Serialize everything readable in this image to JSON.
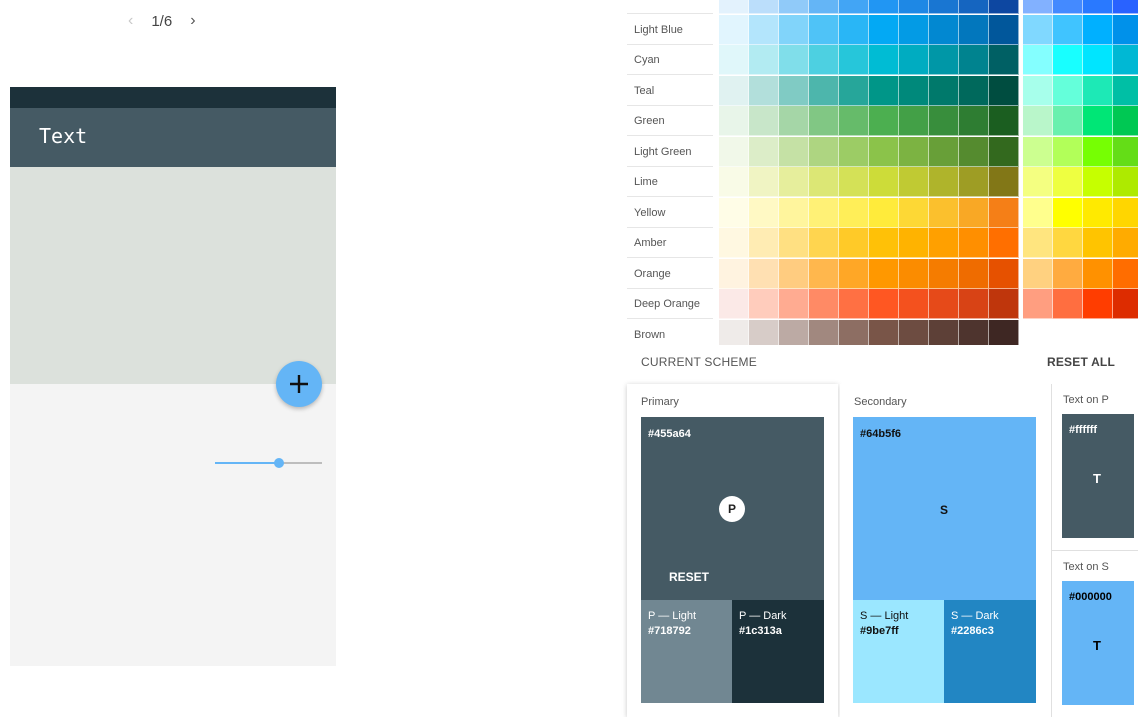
{
  "pager": {
    "prev_icon": "chevron-left-icon",
    "page": "1/6",
    "next_icon": "chevron-right-icon"
  },
  "preview": {
    "statusbar_color": "#1c313a",
    "appbar_color": "#455a64",
    "appbar_title": "Text",
    "content_color": "#dce1dc",
    "background_color": "#f4f4f4",
    "fab_color": "#64b5f6",
    "fab_icon": "plus-icon",
    "slider_color": "#64b5f6",
    "slider_value": 0.6
  },
  "palette": {
    "rows": [
      {
        "name": "",
        "colors": [
          "#e3f2fd",
          "#bbdefb",
          "#90caf9",
          "#64b5f6",
          "#42a5f5",
          "#2196f3",
          "#1e88e5",
          "#1976d2",
          "#1565c0",
          "#0d47a1"
        ],
        "accents": [
          "#82b1ff",
          "#448aff",
          "#2979ff",
          "#2962ff"
        ]
      },
      {
        "name": "Light Blue",
        "colors": [
          "#e1f5fe",
          "#b3e5fc",
          "#81d4fa",
          "#4fc3f7",
          "#29b6f6",
          "#03a9f4",
          "#039be5",
          "#0288d1",
          "#0277bd",
          "#01579b"
        ],
        "accents": [
          "#80d8ff",
          "#40c4ff",
          "#00b0ff",
          "#0091ea"
        ]
      },
      {
        "name": "Cyan",
        "colors": [
          "#e0f7fa",
          "#b2ebf2",
          "#80deea",
          "#4dd0e1",
          "#26c6da",
          "#00bcd4",
          "#00acc1",
          "#0097a7",
          "#00838f",
          "#006064"
        ],
        "accents": [
          "#84ffff",
          "#18ffff",
          "#00e5ff",
          "#00b8d4"
        ]
      },
      {
        "name": "Teal",
        "colors": [
          "#e0f2f1",
          "#b2dfdb",
          "#80cbc4",
          "#4db6ac",
          "#26a69a",
          "#009688",
          "#00897b",
          "#00796b",
          "#00695c",
          "#004d40"
        ],
        "accents": [
          "#a7ffeb",
          "#64ffda",
          "#1de9b6",
          "#00bfa5"
        ]
      },
      {
        "name": "Green",
        "colors": [
          "#e8f5e9",
          "#c8e6c9",
          "#a5d6a7",
          "#81c784",
          "#66bb6a",
          "#4caf50",
          "#43a047",
          "#388e3c",
          "#2e7d32",
          "#1b5e20"
        ],
        "accents": [
          "#b9f6ca",
          "#69f0ae",
          "#00e676",
          "#00c853"
        ]
      },
      {
        "name": "Light Green",
        "colors": [
          "#f1f8e9",
          "#dcedc8",
          "#c5e1a5",
          "#aed581",
          "#9ccc65",
          "#8bc34a",
          "#7cb342",
          "#689f38",
          "#558b2f",
          "#33691e"
        ],
        "accents": [
          "#ccff90",
          "#b2ff59",
          "#76ff03",
          "#64dd17"
        ]
      },
      {
        "name": "Lime",
        "colors": [
          "#f9fbe7",
          "#f0f4c3",
          "#e6ee9c",
          "#dce775",
          "#d4e157",
          "#cddc39",
          "#c0ca33",
          "#afb42b",
          "#9e9d24",
          "#827717"
        ],
        "accents": [
          "#f4ff81",
          "#eeff41",
          "#c6ff00",
          "#aeea00"
        ]
      },
      {
        "name": "Yellow",
        "colors": [
          "#fffde7",
          "#fff9c4",
          "#fff59d",
          "#fff176",
          "#ffee58",
          "#ffeb3b",
          "#fdd835",
          "#fbc02d",
          "#f9a825",
          "#f57f17"
        ],
        "accents": [
          "#ffff8d",
          "#ffff00",
          "#ffea00",
          "#ffd600"
        ]
      },
      {
        "name": "Amber",
        "colors": [
          "#fff8e1",
          "#ffecb3",
          "#ffe082",
          "#ffd54f",
          "#ffca28",
          "#ffc107",
          "#ffb300",
          "#ffa000",
          "#ff8f00",
          "#ff6f00"
        ],
        "accents": [
          "#ffe57f",
          "#ffd740",
          "#ffc400",
          "#ffab00"
        ]
      },
      {
        "name": "Orange",
        "colors": [
          "#fff3e0",
          "#ffe0b2",
          "#ffcc80",
          "#ffb74d",
          "#ffa726",
          "#ff9800",
          "#fb8c00",
          "#f57c00",
          "#ef6c00",
          "#e65100"
        ],
        "accents": [
          "#ffd180",
          "#ffab40",
          "#ff9100",
          "#ff6d00"
        ]
      },
      {
        "name": "Deep Orange",
        "colors": [
          "#fbe9e7",
          "#ffccbc",
          "#ffab91",
          "#ff8a65",
          "#ff7043",
          "#ff5722",
          "#f4511e",
          "#e64a19",
          "#d84315",
          "#bf360c"
        ],
        "accents": [
          "#ff9e80",
          "#ff6e40",
          "#ff3d00",
          "#dd2c00"
        ]
      },
      {
        "name": "Brown",
        "colors": [
          "#efebe9",
          "#d7ccc8",
          "#bcaaa4",
          "#a1887f",
          "#8d6e63",
          "#795548",
          "#6d4c41",
          "#5d4037",
          "#4e342e",
          "#3e2723"
        ],
        "accents": []
      }
    ]
  },
  "scheme": {
    "title": "CURRENT SCHEME",
    "reset_all": "RESET ALL",
    "primary": {
      "label": "Primary",
      "hex": "#455a64",
      "badge": "P",
      "reset": "RESET",
      "light_label": "P — Light",
      "light_hex": "#718792",
      "dark_label": "P — Dark",
      "dark_hex": "#1c313a"
    },
    "secondary": {
      "label": "Secondary",
      "hex": "#64b5f6",
      "badge": "S",
      "light_label": "S — Light",
      "light_hex": "#9be7ff",
      "dark_label": "S — Dark",
      "dark_hex": "#2286c3"
    },
    "text_on_p": {
      "label": "Text on P",
      "hex": "#ffffff",
      "glyph": "T"
    },
    "text_on_s": {
      "label": "Text on S",
      "hex": "#000000",
      "glyph": "T"
    }
  }
}
